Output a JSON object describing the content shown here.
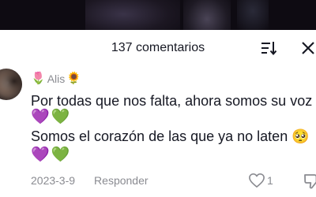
{
  "header": {
    "comments_count_label": "137 comentarios"
  },
  "comment": {
    "username": "Alis",
    "username_emoji_left": "🌷",
    "username_emoji_right": "🌻",
    "line1": "Por todas que nos falta, ahora somos su voz",
    "line2_hearts": "💜💚",
    "line3": "Somos el corazón de las que ya no laten 🥺",
    "line4_hearts": "💜💚",
    "date": "2023-3-9",
    "reply_label": "Responder",
    "like_count": "1"
  },
  "icons": {
    "sort": "sort-icon",
    "close": "close-icon",
    "like": "heart-outline-icon",
    "dislike": "thumbs-down-icon"
  },
  "colors": {
    "text_primary": "#161823",
    "text_secondary": "#8a8b91",
    "background": "#ffffff"
  }
}
